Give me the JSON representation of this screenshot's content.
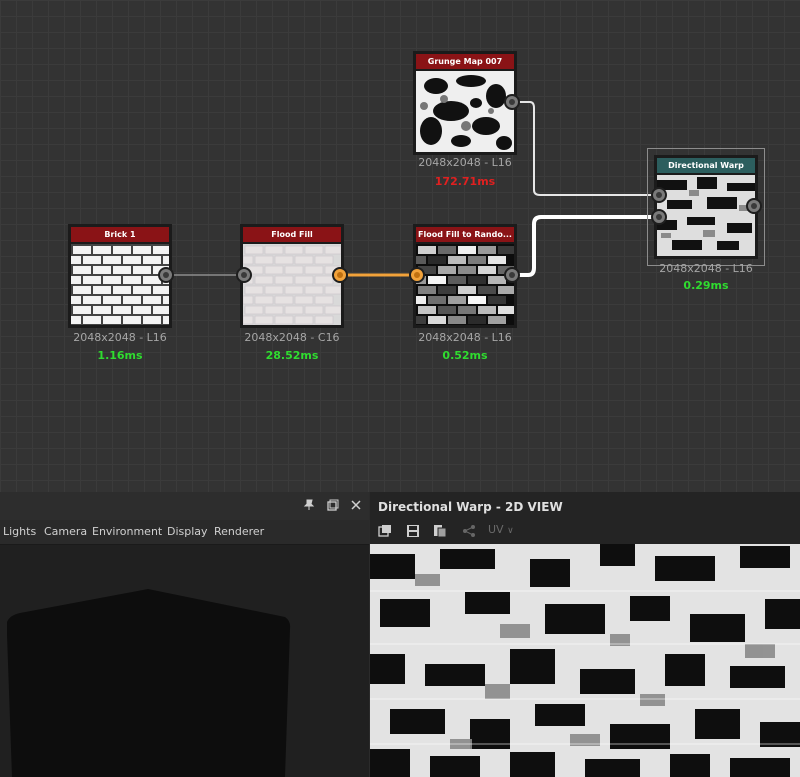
{
  "graph": {
    "nodes": [
      {
        "id": "brick",
        "title": "Brick 1",
        "resolution": "2048x2048 - L16",
        "time": "1.16ms"
      },
      {
        "id": "flood",
        "title": "Flood Fill",
        "resolution": "2048x2048 - C16",
        "time": "28.52ms"
      },
      {
        "id": "random",
        "title": "Flood Fill to Rando...",
        "resolution": "2048x2048 - L16",
        "time": "0.52ms"
      },
      {
        "id": "grunge",
        "title": "Grunge Map 007",
        "resolution": "2048x2048 - L16",
        "time": "172.71ms"
      },
      {
        "id": "warp",
        "title": "Directional Warp",
        "resolution": "2048x2048 - L16",
        "time": "0.29ms"
      }
    ],
    "colors": {
      "node_header": "#8a1316",
      "warp_header": "#2c5e5e",
      "fast_time": "#2fdc2f",
      "slow_time": "#e02020",
      "color_wire": "#f2a23a",
      "gray_wire": "#ffffff"
    }
  },
  "view3d": {
    "icons": [
      "pin-icon",
      "restore-icon",
      "close-icon"
    ],
    "menu": [
      "Lights",
      "Camera",
      "Environment",
      "Display",
      "Renderer"
    ]
  },
  "view2d": {
    "title": "Directional Warp - 2D VIEW",
    "icons": [
      "copy-icon",
      "save-icon",
      "export-icon",
      "graph-icon"
    ],
    "uv_label": "UV"
  }
}
